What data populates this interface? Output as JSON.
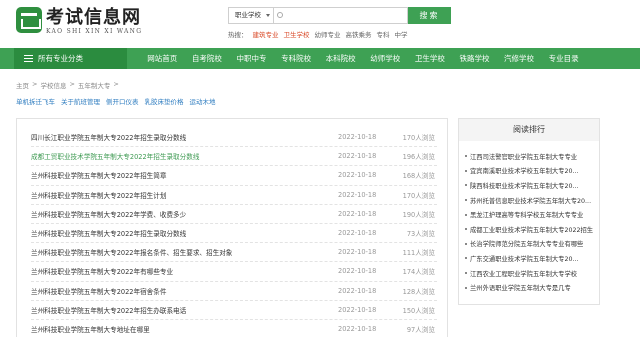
{
  "logo": {
    "title": "考试信息网",
    "subtitle": "KAO SHI XIN XI WANG"
  },
  "search": {
    "select_value": "职业学校",
    "placeholder": "",
    "button": "搜索",
    "hot_label": "热搜：",
    "hot_links": [
      {
        "label": "建筑专业",
        "highlight": true
      },
      {
        "label": "卫生学校",
        "highlight": true
      },
      {
        "label": "幼师专业",
        "highlight": false
      },
      {
        "label": "高铁乘务",
        "highlight": false
      },
      {
        "label": "专科",
        "highlight": false
      },
      {
        "label": "中学",
        "highlight": false
      }
    ]
  },
  "nav": {
    "category": "所有专业分类",
    "links": [
      "网站首页",
      "自考院校",
      "中职中专",
      "专科院校",
      "本科院校",
      "幼师学校",
      "卫生学校",
      "铁路学校",
      "汽修学校",
      "专业目录"
    ]
  },
  "breadcrumb": [
    "主页",
    ">",
    "学校信息",
    ">",
    "五年制大专",
    ">"
  ],
  "tags": [
    "单机拆迁飞车",
    "关于航班管理",
    "侧开口仪表",
    "乳胶床垫价格",
    "运动木地"
  ],
  "articles": [
    {
      "title": "四川长江职业学院五年制大专2022年招生录取分数线",
      "date": "2022-10-18",
      "views": "170人浏览",
      "active": false
    },
    {
      "title": "成都工贸职业技术学院五年制大专2022年招生录取分数线",
      "date": "2022-10-18",
      "views": "196人浏览",
      "active": true
    },
    {
      "title": "兰州科技职业学院五年制大专2022年招生简章",
      "date": "2022-10-18",
      "views": "168人浏览",
      "active": false
    },
    {
      "title": "兰州科技职业学院五年制大专2022年招生计划",
      "date": "2022-10-18",
      "views": "170人浏览",
      "active": false
    },
    {
      "title": "兰州科技职业学院五年制大专2022年学费、收费多少",
      "date": "2022-10-18",
      "views": "190人浏览",
      "active": false
    },
    {
      "title": "兰州科技职业学院五年制大专2022年招生录取分数线",
      "date": "2022-10-18",
      "views": "73人浏览",
      "active": false
    },
    {
      "title": "兰州科技职业学院五年制大专2022年报名条件、招生要求、招生对象",
      "date": "2022-10-18",
      "views": "111人浏览",
      "active": false
    },
    {
      "title": "兰州科技职业学院五年制大专2022年有哪些专业",
      "date": "2022-10-18",
      "views": "174人浏览",
      "active": false
    },
    {
      "title": "兰州科技职业学院五年制大专2022年宿舍条件",
      "date": "2022-10-18",
      "views": "128人浏览",
      "active": false
    },
    {
      "title": "兰州科技职业学院五年制大专2022年招生办联系电话",
      "date": "2022-10-18",
      "views": "150人浏览",
      "active": false
    },
    {
      "title": "兰州科技职业学院五年制大专地址在哪里",
      "date": "2022-10-18",
      "views": "97人浏览",
      "active": false
    }
  ],
  "sidebar": {
    "title": "阅读排行",
    "items": [
      "江西司法警官职业学院五年制大专专业",
      "宜宾南溪职业技术学校五年制大专20...",
      "陕西科技职业技术学院五年制大专20...",
      "苏州托普信息职业技术学院五年制大专20...",
      "黑龙江护理高等专科学校五年制大专专业",
      "成都工业职业技术学院五年制大专2022招生计划",
      "长治学院师范分院五年制大专专业有哪些",
      "广东交通职业技术学院五年制大专20...",
      "江西农业工程职业学院五年制大专学校",
      "兰州外语职业学院五年制大专是几专"
    ]
  },
  "colors": {
    "brand_green": "#3ea154",
    "dark_green": "#2b8c3f",
    "hot_red": "#d94a28",
    "link_blue": "#2f7dc0"
  }
}
